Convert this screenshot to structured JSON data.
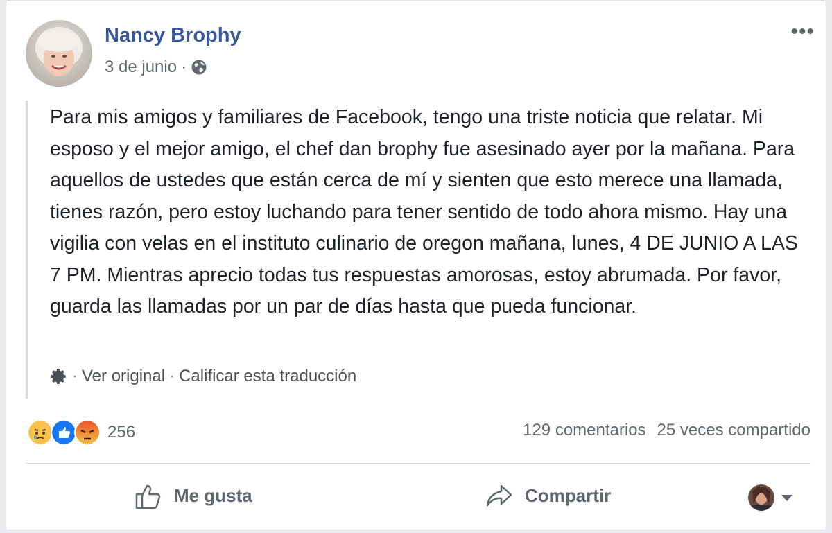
{
  "post": {
    "author": "Nancy Brophy",
    "date": "3 de junio",
    "separator": "·",
    "body": "Para mis amigos y familiares de Facebook, tengo una triste noticia que relatar. Mi esposo y el mejor amigo, el chef dan brophy fue asesinado ayer por la mañana. Para aquellos de ustedes que están cerca de mí y sienten que esto merece una llamada, tienes razón, pero estoy luchando para tener sentido de todo ahora mismo. Hay una vigilia con velas en el instituto culinario de oregon mañana, lunes, 4 DE JUNIO A LAS 7 PM. Mientras aprecio todas tus respuestas amorosas, estoy abrumada. Por favor, guarda las llamadas por un par de días hasta que pueda funcionar.",
    "translation": {
      "separator": "·",
      "view_original": "Ver original",
      "rate_translation": "Calificar esta traducción"
    }
  },
  "reactions": {
    "icons": [
      "sad-icon",
      "like-icon",
      "angry-icon"
    ],
    "count": "256"
  },
  "stats": {
    "comments": "129 comentarios",
    "shares": "25 veces compartido"
  },
  "actions": {
    "like_label": "Me gusta",
    "share_label": "Compartir"
  },
  "colors": {
    "link_blue": "#365899",
    "like_blue": "#1877f2",
    "text": "#1d2129",
    "muted": "#606770"
  }
}
